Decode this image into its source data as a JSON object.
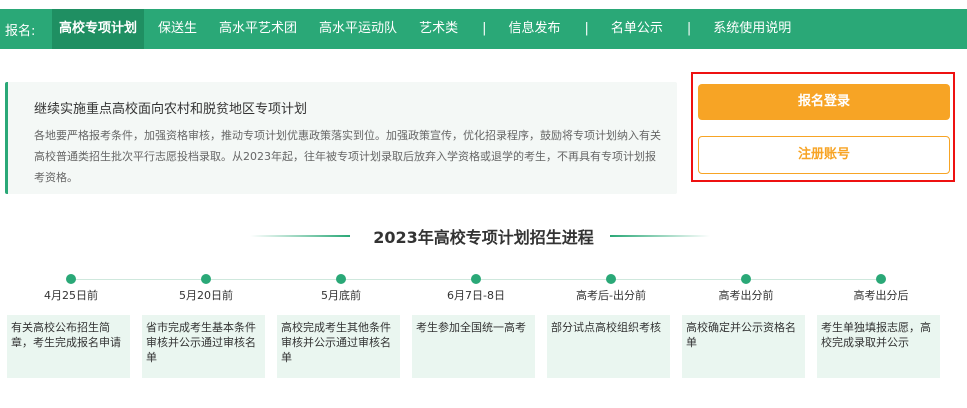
{
  "nav": {
    "prefix": "报名:",
    "items": [
      {
        "label": "高校专项计划",
        "active": true
      },
      {
        "label": "保送生"
      },
      {
        "label": "高水平艺术团"
      },
      {
        "label": "高水平运动队"
      },
      {
        "label": "艺术类"
      },
      {
        "label": "信息发布"
      },
      {
        "label": "名单公示"
      },
      {
        "label": "系统使用说明"
      }
    ],
    "separator": "|"
  },
  "notice": {
    "title": "继续实施重点高校面向农村和脱贫地区专项计划",
    "body": "各地要严格报考条件，加强资格审核，推动专项计划优惠政策落实到位。加强政策宣传，优化招录程序，鼓励将专项计划纳入有关高校普通类招生批次平行志愿投档录取。从2023年起，往年被专项计划录取后放弃入学资格或退学的考生，不再具有专项计划报考资格。"
  },
  "auth": {
    "login_label": "报名登录",
    "register_label": "注册账号"
  },
  "timeline": {
    "title": "2023年高校专项计划招生进程",
    "steps": [
      {
        "date": "4月25日前",
        "text": "有关高校公布招生简章，考生完成报名申请"
      },
      {
        "date": "5月20日前",
        "text": "省市完成考生基本条件审核并公示通过审核名单"
      },
      {
        "date": "5月底前",
        "text": "高校完成考生其他条件审核并公示通过审核名单"
      },
      {
        "date": "6月7日-8日",
        "text": "考生参加全国统一高考"
      },
      {
        "date": "高考后-出分前",
        "text": "部分试点高校组织考核"
      },
      {
        "date": "高考出分前",
        "text": "高校确定并公示资格名单"
      },
      {
        "date": "高考出分后",
        "text": "考生单独填报志愿，高校完成录取并公示"
      }
    ]
  },
  "colors": {
    "brand_green": "#2aa877",
    "active_green": "#1f8f62",
    "accent_orange": "#f7a425",
    "highlight_red": "#ee1111"
  }
}
